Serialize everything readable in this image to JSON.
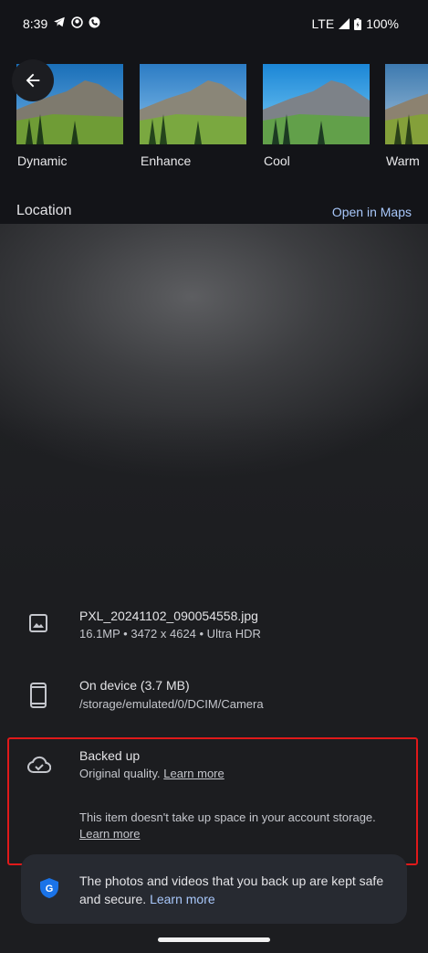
{
  "status_bar": {
    "time": "8:39",
    "network": "LTE",
    "battery": "100%"
  },
  "filters": [
    {
      "label": "Dynamic"
    },
    {
      "label": "Enhance"
    },
    {
      "label": "Cool"
    },
    {
      "label": "Warm"
    }
  ],
  "location": {
    "heading": "Location",
    "open_maps": "Open in Maps"
  },
  "file": {
    "name": "PXL_20241102_090054558.jpg",
    "meta": "16.1MP  •  3472 x 4624  •  Ultra HDR"
  },
  "device": {
    "title": "On device (3.7 MB)",
    "path": "/storage/emulated/0/DCIM/Camera"
  },
  "backup": {
    "title": "Backed up",
    "quality": "Original quality.",
    "learn_more": "Learn more",
    "storage_note": "This item doesn't take up space in your account storage.",
    "storage_learn_more": "Learn more"
  },
  "secure_card": {
    "text": "The photos and videos that you back up are kept safe and secure.",
    "link": "Learn more"
  },
  "icons": {
    "back": "arrow-left-icon",
    "image": "image-icon",
    "phone": "phone-icon",
    "cloud": "cloud-done-icon",
    "shield": "google-shield-icon"
  }
}
